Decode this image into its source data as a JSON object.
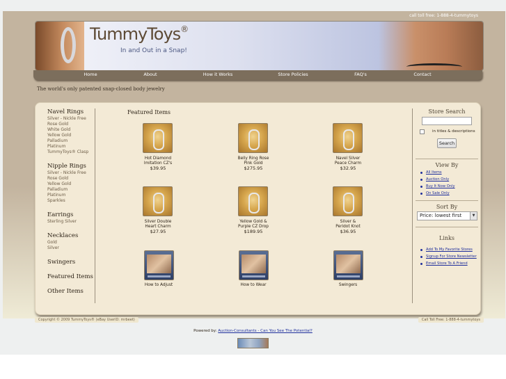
{
  "header": {
    "call_toll_free": "call toll free: 1-888-4-tummytoys",
    "logo_text": "TummyToys",
    "logo_reg": "®",
    "tagline": "In and Out in a Snap!"
  },
  "nav": {
    "items": [
      {
        "label": "Home"
      },
      {
        "label": "About"
      },
      {
        "label": "How it Works"
      },
      {
        "label": "Store Policies"
      },
      {
        "label": "FAQ's"
      },
      {
        "label": "Contact"
      }
    ]
  },
  "tagline_worlds": "The world's only patented snap-closed body jewelry",
  "sidebar": {
    "sections": [
      {
        "title": "Navel Rings",
        "items": [
          "Silver - Nickle Free",
          "Rose Gold",
          "White Gold",
          "Yellow Gold",
          "Palladium",
          "Platinum",
          "TummyToys® Clasp"
        ]
      },
      {
        "title": "Nipple Rings",
        "items": [
          "Silver - Nickle Free",
          "Rose Gold",
          "Yellow Gold",
          "Palladium",
          "Platinum",
          "Sparkles"
        ]
      },
      {
        "title": "Earrings",
        "items": [
          "Sterling Silver"
        ]
      },
      {
        "title": "Necklaces",
        "items": [
          "Gold",
          "Silver"
        ]
      },
      {
        "title": "Swingers",
        "items": []
      },
      {
        "title": "Featured Items",
        "items": []
      },
      {
        "title": "Other Items",
        "items": []
      }
    ]
  },
  "featured": {
    "title": "Featured Items",
    "products": [
      {
        "name_line1": "Hot Diamond",
        "name_line2": "Imitation CZ's",
        "price": "$39.95",
        "image_icon": "navel-ring-photo"
      },
      {
        "name_line1": "Belly Ring Rose",
        "name_line2": "Pink Gold",
        "price": "$275.95",
        "image_icon": "navel-ring-photo"
      },
      {
        "name_line1": "Navel Silver",
        "name_line2": "Peace Charm",
        "price": "$32.95",
        "image_icon": "peace-charm-photo"
      },
      {
        "name_line1": "Silver Double",
        "name_line2": "Heart Charm",
        "price": "$27.95",
        "image_icon": "heart-charm-photo"
      },
      {
        "name_line1": "Yellow Gold &",
        "name_line2": "Purple CZ Drop",
        "price": "$189.95",
        "image_icon": "drop-charm-photo"
      },
      {
        "name_line1": "Silver &",
        "name_line2": "Peridot Knot",
        "price": "$36.95",
        "image_icon": "knot-charm-photo"
      },
      {
        "name_line1": "How to Adjust",
        "name_line2": "",
        "price": "",
        "image_icon": "video-thumbnail"
      },
      {
        "name_line1": "How to Wear",
        "name_line2": "",
        "price": "",
        "image_icon": "video-thumbnail"
      },
      {
        "name_line1": "Swingers",
        "name_line2": "",
        "price": "",
        "image_icon": "video-thumbnail"
      }
    ]
  },
  "right": {
    "store_search": "Store Search",
    "search_value": "",
    "titles_desc": "in titles & descriptions",
    "search_button": "Search",
    "view_by": "View By",
    "view_links": [
      "All Items",
      "Auction Only",
      "Buy It Now Only",
      "On Sale Only"
    ],
    "sort_by": "Sort By",
    "sort_value": "Price: lowest first",
    "links_title": "Links",
    "links": [
      "Add To My Favorite Stores",
      "Signup For Store Newsletter",
      "Email Store To A Friend"
    ]
  },
  "footer": {
    "copyright": "Copyright © 2009 TummyToys® (eBay UserID: mrbeet)",
    "call_toll_free": "Call Toll Free: 1-888-4-tummytoys",
    "powered_by": "Powered by:",
    "powered_link": "Auction-Consultants - Can You See The Potential?"
  },
  "colors": {
    "frame_brown": "#c3b49f",
    "panel_cream": "#f3ead6",
    "nav_bar": "#7c6e5c",
    "link_blue": "#1e2e9c"
  }
}
